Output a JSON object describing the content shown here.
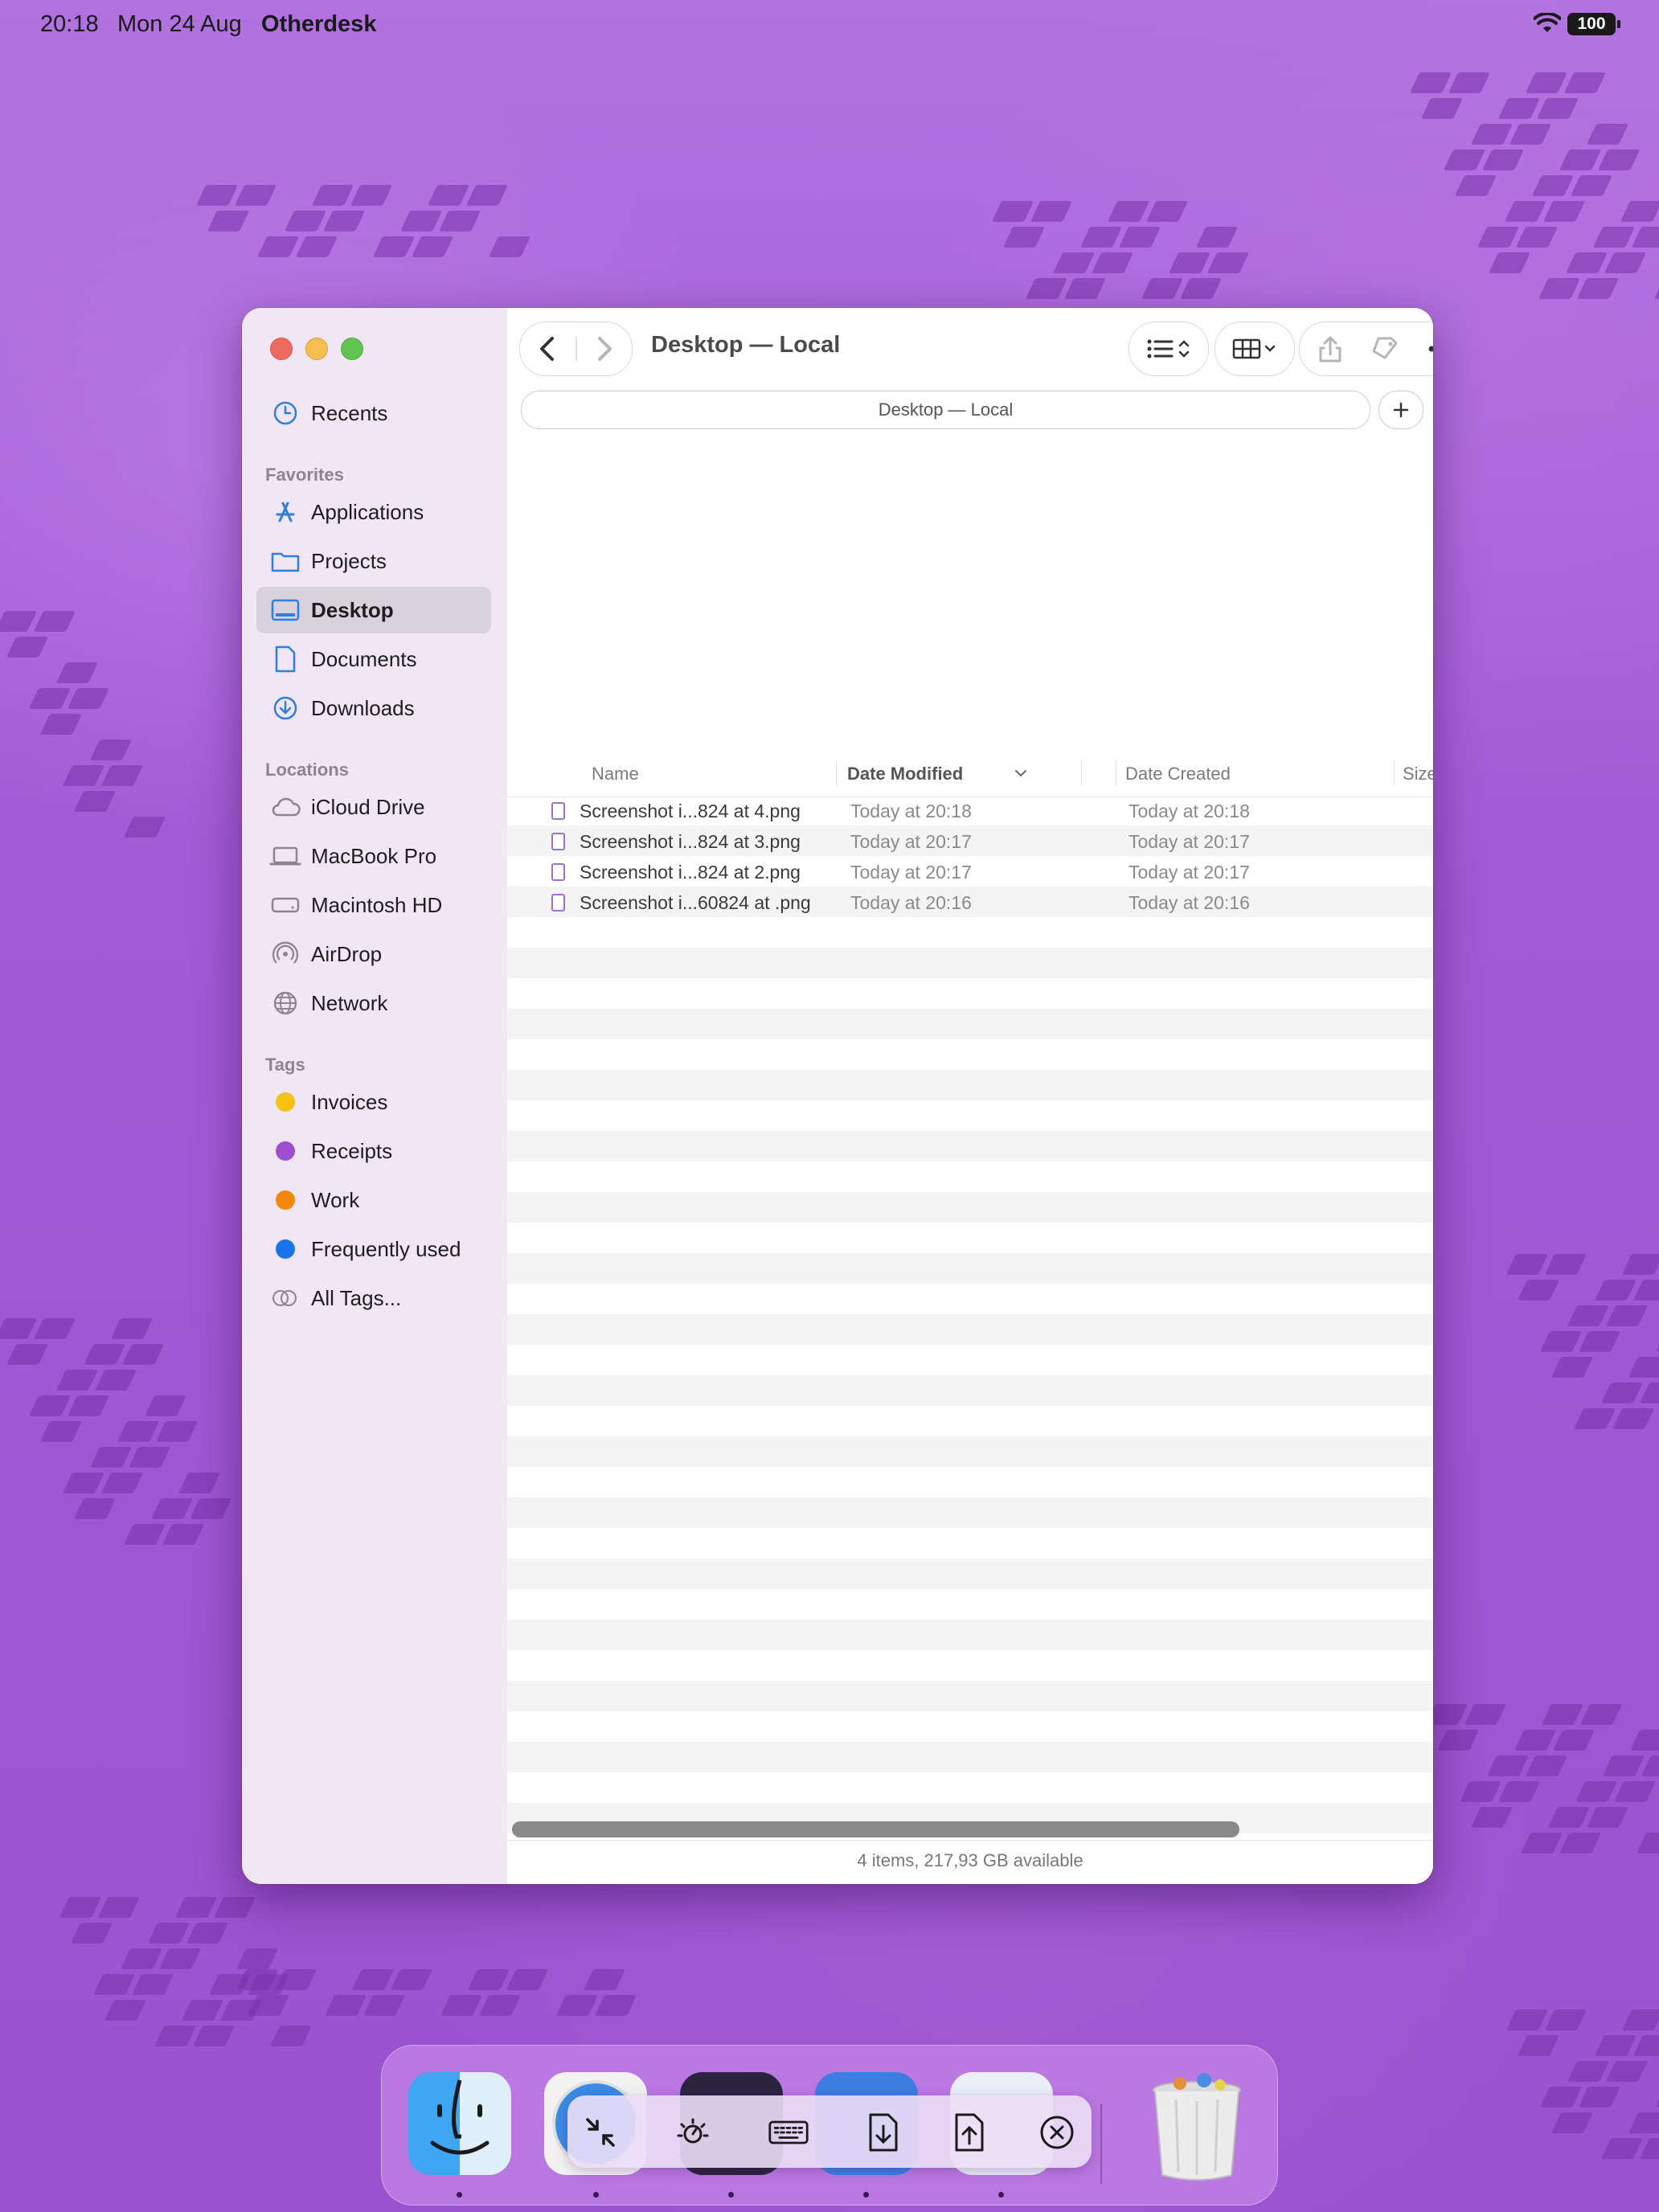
{
  "status_bar": {
    "time": "20:18",
    "date": "Mon 24 Aug",
    "app_name": "Otherdesk",
    "battery": "100"
  },
  "finder": {
    "title": "Desktop — Local",
    "path_bar": "Desktop — Local",
    "sidebar": {
      "recents": "Recents",
      "favorites_header": "Favorites",
      "favorites": [
        {
          "label": "Applications",
          "icon": "applications-icon"
        },
        {
          "label": "Projects",
          "icon": "folder-icon"
        },
        {
          "label": "Desktop",
          "icon": "desktop-icon",
          "selected": true
        },
        {
          "label": "Documents",
          "icon": "document-icon"
        },
        {
          "label": "Downloads",
          "icon": "downloads-icon"
        }
      ],
      "locations_header": "Locations",
      "locations": [
        {
          "label": "iCloud Drive",
          "icon": "cloud-icon"
        },
        {
          "label": "MacBook Pro",
          "icon": "laptop-icon"
        },
        {
          "label": "Macintosh HD",
          "icon": "drive-icon"
        },
        {
          "label": "AirDrop",
          "icon": "airdrop-icon"
        },
        {
          "label": "Network",
          "icon": "globe-icon"
        }
      ],
      "tags_header": "Tags",
      "tags": [
        {
          "label": "Invoices",
          "color": "#f5c211"
        },
        {
          "label": "Receipts",
          "color": "#9b4fd0"
        },
        {
          "label": "Work",
          "color": "#f4880c"
        },
        {
          "label": "Frequently used",
          "color": "#1a73e8"
        },
        {
          "label": "All Tags...",
          "color": "none"
        }
      ]
    },
    "columns": {
      "name": "Name",
      "date_modified": "Date Modified",
      "date_created": "Date Created",
      "size": "Size"
    },
    "files": [
      {
        "name": "Screenshot i...824 at  4.png",
        "modified": "Today at 20:18",
        "created": "Today at 20:18"
      },
      {
        "name": "Screenshot i...824 at  3.png",
        "modified": "Today at 20:17",
        "created": "Today at 20:17"
      },
      {
        "name": "Screenshot i...824 at  2.png",
        "modified": "Today at 20:17",
        "created": "Today at 20:17"
      },
      {
        "name": "Screenshot i...60824 at .png",
        "modified": "Today at 20:16",
        "created": "Today at 20:16"
      }
    ],
    "status": "4 items, 217,93 GB available"
  },
  "dock": {
    "apps": [
      "finder-icon",
      "safari-icon",
      "app3-icon",
      "app4-icon",
      "app5-icon",
      "trash-icon"
    ],
    "overlay_tools": [
      "collapse-icon",
      "brightness-icon",
      "keyboard-icon",
      "download-file-icon",
      "upload-file-icon",
      "close-circle-icon"
    ]
  }
}
